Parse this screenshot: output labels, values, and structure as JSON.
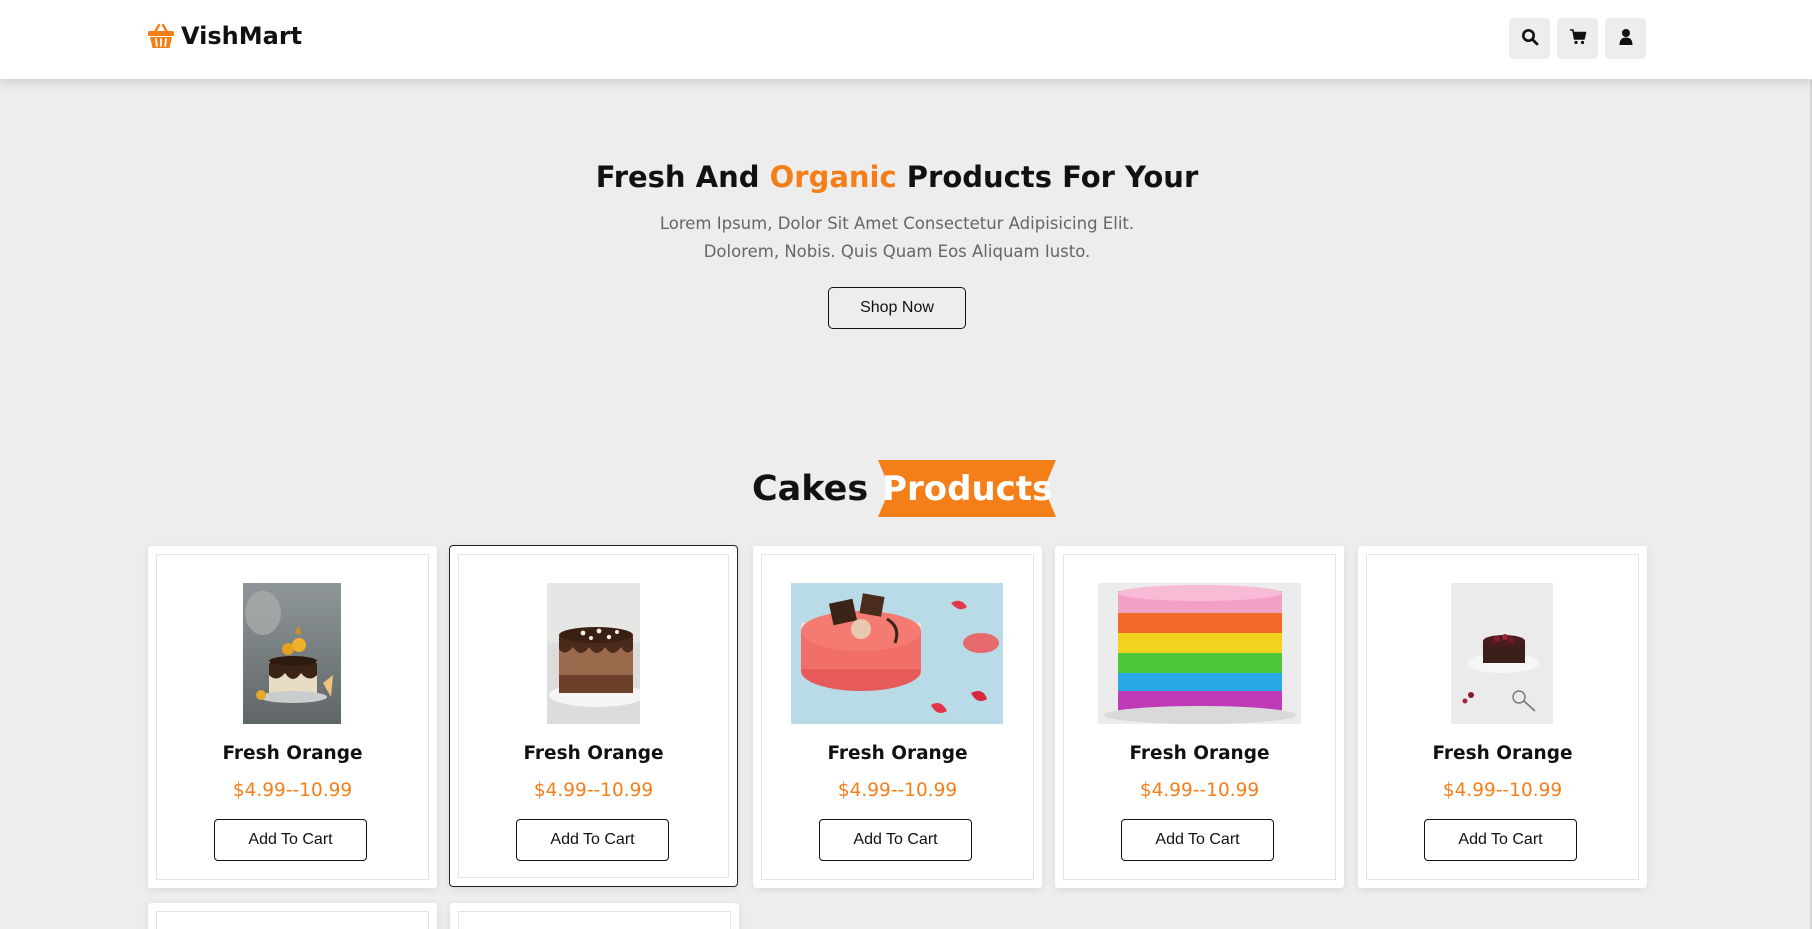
{
  "brand": {
    "name": "VishMart",
    "color": "#f47f19"
  },
  "header": {
    "icons": [
      "search-icon",
      "cart-icon",
      "user-icon"
    ]
  },
  "hero": {
    "title_before": "Fresh And ",
    "title_accent": "Organic",
    "title_after": " Products For Your",
    "description": "Lorem Ipsum, Dolor Sit Amet Consectetur Adipisicing Elit. Dolorem, Nobis. Quis Quam Eos Aliquam Iusto.",
    "button": "Shop Now"
  },
  "section": {
    "word": "Cakes",
    "ribbon": "Products"
  },
  "products": [
    {
      "name": "Fresh Orange",
      "price": "$4.99--10.99",
      "button": "Add To Cart",
      "image": "dark chocolate drip cake with orange slices"
    },
    {
      "name": "Fresh Orange",
      "price": "$4.99--10.99",
      "button": "Add To Cart",
      "image": "chocolate mousse cake"
    },
    {
      "name": "Fresh Orange",
      "price": "$4.99--10.99",
      "button": "Add To Cart",
      "image": "red mirror glaze cake with macaron"
    },
    {
      "name": "Fresh Orange",
      "price": "$4.99--10.99",
      "button": "Add To Cart",
      "image": "rainbow rosette cake"
    },
    {
      "name": "Fresh Orange",
      "price": "$4.99--10.99",
      "button": "Add To Cart",
      "image": "small dark cake with berries"
    }
  ],
  "colors": {
    "accent": "#f47f19",
    "background": "#ededed",
    "header": "#ffffff"
  }
}
